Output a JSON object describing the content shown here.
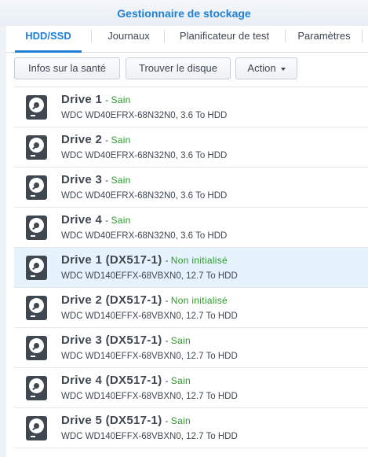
{
  "window": {
    "title": "Gestionnaire de stockage"
  },
  "tabs": [
    {
      "label": "HDD/SSD",
      "active": true
    },
    {
      "label": "Journaux",
      "active": false
    },
    {
      "label": "Planificateur de test",
      "active": false
    },
    {
      "label": "Paramètres",
      "active": false
    }
  ],
  "toolbar": {
    "health_label": "Infos sur la santé",
    "locate_label": "Trouver le disque",
    "action_label": "Action"
  },
  "status_colors": {
    "Sain": "#2a9c2a",
    "Non initialisé": "#2a9c2a"
  },
  "drives": [
    {
      "name": "Drive 1",
      "separator": "-",
      "status": "Sain",
      "description": "WDC WD40EFRX-68N32N0, 3.6 To HDD",
      "icon": "hard-disk-icon",
      "selected": false
    },
    {
      "name": "Drive 2",
      "separator": "-",
      "status": "Sain",
      "description": "WDC WD40EFRX-68N32N0, 3.6 To HDD",
      "icon": "hard-disk-icon",
      "selected": false
    },
    {
      "name": "Drive 3",
      "separator": "-",
      "status": "Sain",
      "description": "WDC WD40EFRX-68N32N0, 3.6 To HDD",
      "icon": "hard-disk-icon",
      "selected": false
    },
    {
      "name": "Drive 4",
      "separator": "-",
      "status": "Sain",
      "description": "WDC WD40EFRX-68N32N0, 3.6 To HDD",
      "icon": "hard-disk-icon",
      "selected": false
    },
    {
      "name": "Drive 1 (DX517-1)",
      "separator": "-",
      "status": "Non initialisé",
      "description": "WDC WD140EFFX-68VBXN0, 12.7 To HDD",
      "icon": "hard-disk-icon",
      "selected": true
    },
    {
      "name": "Drive 2 (DX517-1)",
      "separator": "-",
      "status": "Non initialisé",
      "description": "WDC WD140EFFX-68VBXN0, 12.7 To HDD",
      "icon": "hard-disk-icon",
      "selected": false
    },
    {
      "name": "Drive 3 (DX517-1)",
      "separator": "-",
      "status": "Sain",
      "description": "WDC WD140EFFX-68VBXN0, 12.7 To HDD",
      "icon": "hard-disk-icon",
      "selected": false
    },
    {
      "name": "Drive 4 (DX517-1)",
      "separator": "-",
      "status": "Sain",
      "description": "WDC WD140EFFX-68VBXN0, 12.7 To HDD",
      "icon": "hard-disk-icon",
      "selected": false
    },
    {
      "name": "Drive 5 (DX517-1)",
      "separator": "-",
      "status": "Sain",
      "description": "WDC WD140EFFX-68VBXN0, 12.7 To HDD",
      "icon": "hard-disk-icon",
      "selected": false
    }
  ]
}
